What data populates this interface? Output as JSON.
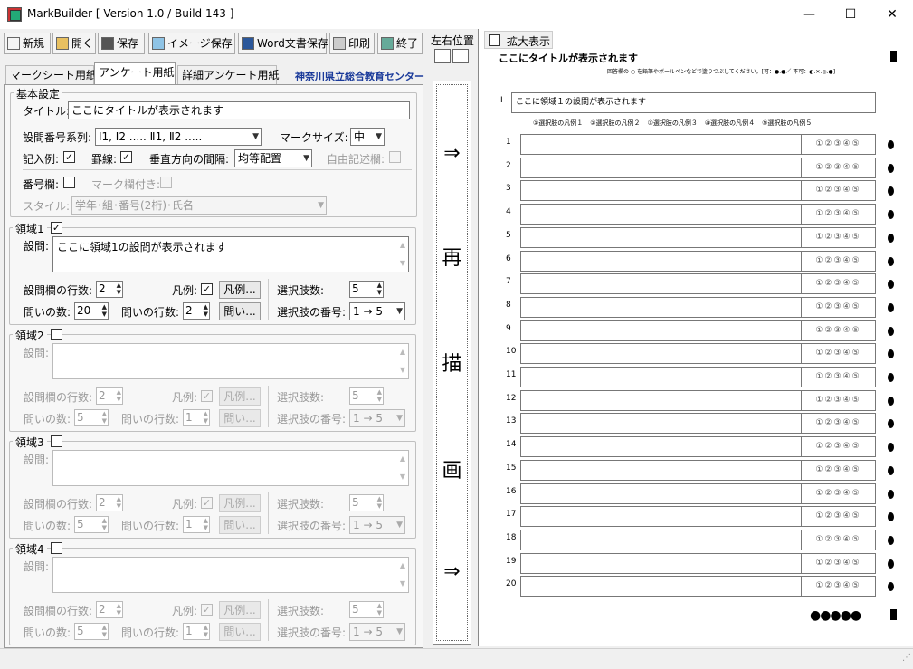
{
  "window": {
    "title": "MarkBuilder [ Version 1.0 / Build 143 ]",
    "minimize": "—",
    "maximize": "☐",
    "close": "✕"
  },
  "toolbar": {
    "new": "新規",
    "open": "開く",
    "save": "保存",
    "image_save": "イメージ保存",
    "word_save": "Word文書保存",
    "print": "印刷",
    "exit": "終了"
  },
  "tabs": [
    "マークシート用紙",
    "アンケート用紙",
    "詳細アンケート用紙"
  ],
  "school": "神奈川県立総合教育センター",
  "basic": {
    "legend": "基本設定",
    "title_label": "タイトル:",
    "title_value": "ここにタイトルが表示されます",
    "series_label": "設問番号系列:",
    "series_value": "Ⅰ1, Ⅰ2 ..... Ⅱ1, Ⅱ2 .....",
    "marksize_label": "マークサイズ:",
    "marksize_value": "中",
    "example_label": "記入例:",
    "border_label": "罫線:",
    "vspacing_label": "垂直方向の間隔:",
    "vspacing_value": "均等配置",
    "freetext_label": "自由記述欄:",
    "number_label": "番号欄:",
    "markcol_label": "マーク欄付き:",
    "style_label": "スタイル:",
    "style_value": "学年･組･番号(2桁)･氏名"
  },
  "area_labels": {
    "question": "設問:",
    "question_rows": "設問欄の行数:",
    "legend": "凡例:",
    "legend_btn": "凡例...",
    "choices": "選択肢数:",
    "item_count": "問いの数:",
    "item_rows": "問いの行数:",
    "item_btn": "問い...",
    "choice_numbering": "選択肢の番号:"
  },
  "areas": [
    {
      "name": "領域1",
      "checked": true,
      "question": "ここに領域1の設問が表示されます",
      "question_rows": "2",
      "choices": "5",
      "item_count": "20",
      "item_rows": "2",
      "numbering": "1 → 5"
    },
    {
      "name": "領域2",
      "checked": false,
      "question": "",
      "question_rows": "2",
      "choices": "5",
      "item_count": "5",
      "item_rows": "1",
      "numbering": "1 → 5"
    },
    {
      "name": "領域3",
      "checked": false,
      "question": "",
      "question_rows": "2",
      "choices": "5",
      "item_count": "5",
      "item_rows": "1",
      "numbering": "1 → 5"
    },
    {
      "name": "領域4",
      "checked": false,
      "question": "",
      "question_rows": "2",
      "choices": "5",
      "item_count": "5",
      "item_rows": "1",
      "numbering": "1 → 5"
    }
  ],
  "position_label": "左右位置",
  "redraw_chars": [
    "⇒",
    "再",
    "描",
    "画",
    "⇒"
  ],
  "preview": {
    "zoom_label": "拡大表示",
    "title": "ここにタイトルが表示されます",
    "instruction": "回答欄の ○ を鉛筆やボールペンなどで塗りつぶしてください。[可：●.●／ 不可：◐.✕.◎.●]",
    "section_num": "I",
    "section_question": "ここに領域１の設問が表示されます",
    "legend_items": [
      "①選択肢の凡例１",
      "②選択肢の凡例２",
      "③選択肢の凡例３",
      "④選択肢の凡例４",
      "⑤選択肢の凡例５"
    ],
    "bubbles": "①②③④⑤",
    "rows": [
      "1",
      "2",
      "3",
      "4",
      "5",
      "6",
      "7",
      "8",
      "9",
      "10",
      "11",
      "12",
      "13",
      "14",
      "15",
      "16",
      "17",
      "18",
      "19",
      "20"
    ]
  }
}
